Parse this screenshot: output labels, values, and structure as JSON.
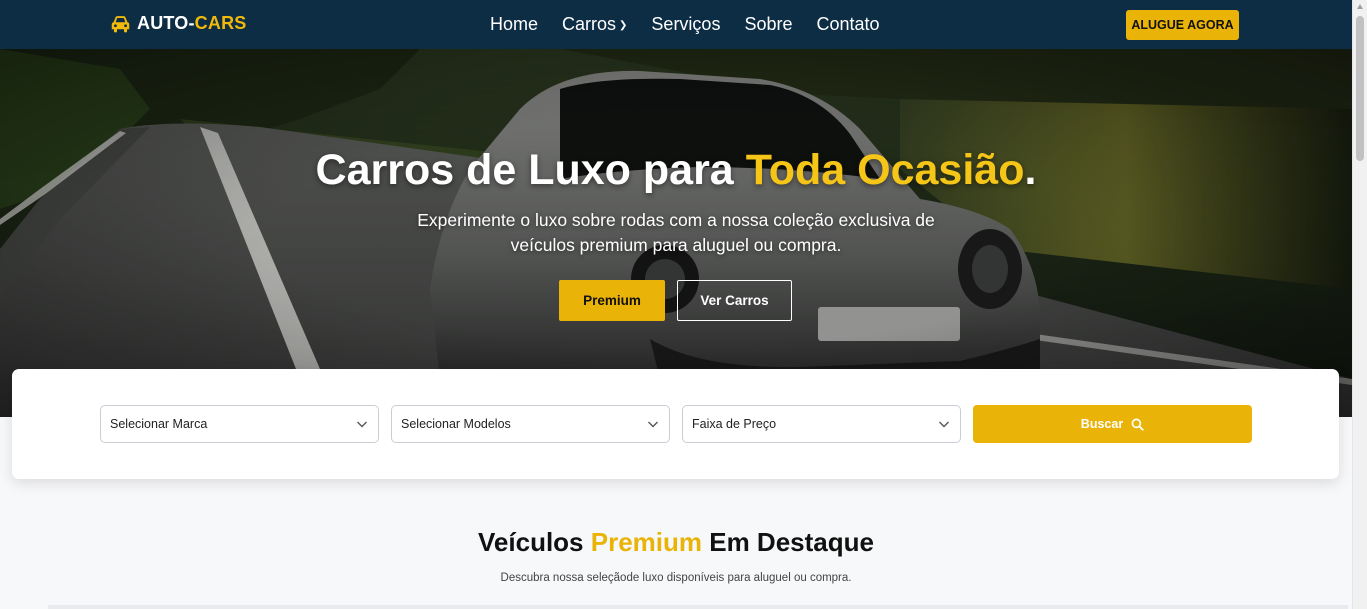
{
  "nav": {
    "brand_main": "AUTO-",
    "brand_accent": "CARS",
    "links": [
      {
        "label": "Home"
      },
      {
        "label": "Carros",
        "has_dropdown": true
      },
      {
        "label": "Serviços"
      },
      {
        "label": "Sobre"
      },
      {
        "label": "Contato"
      }
    ],
    "cta": "ALUGUE AGORA"
  },
  "hero": {
    "title_main": "Carros de Luxo para ",
    "title_accent": "Toda Ocasião",
    "title_end": ".",
    "subtitle": "Experimente o luxo sobre rodas com a nossa coleção exclusiva de veículos premium para aluguel ou compra.",
    "btn_primary": "Premium",
    "btn_secondary": "Ver Carros"
  },
  "search": {
    "brand_select": "Selecionar Marca",
    "model_select": "Selecionar Modelos",
    "price_select": "Faixa de Preço",
    "button": "Buscar"
  },
  "featured": {
    "title_a": "Veículos ",
    "title_accent": "Premium",
    "title_b": " Em Destaque",
    "subtitle": "Descubra nossa seleçãode luxo disponíveis para aluguel ou compra."
  },
  "colors": {
    "navbar": "#0d2d45",
    "accent": "#eab308",
    "hero_accent": "#f5c518"
  },
  "icons": {
    "brand": "car-icon",
    "search": "search-icon",
    "dropdown": "chevron-down-icon"
  }
}
